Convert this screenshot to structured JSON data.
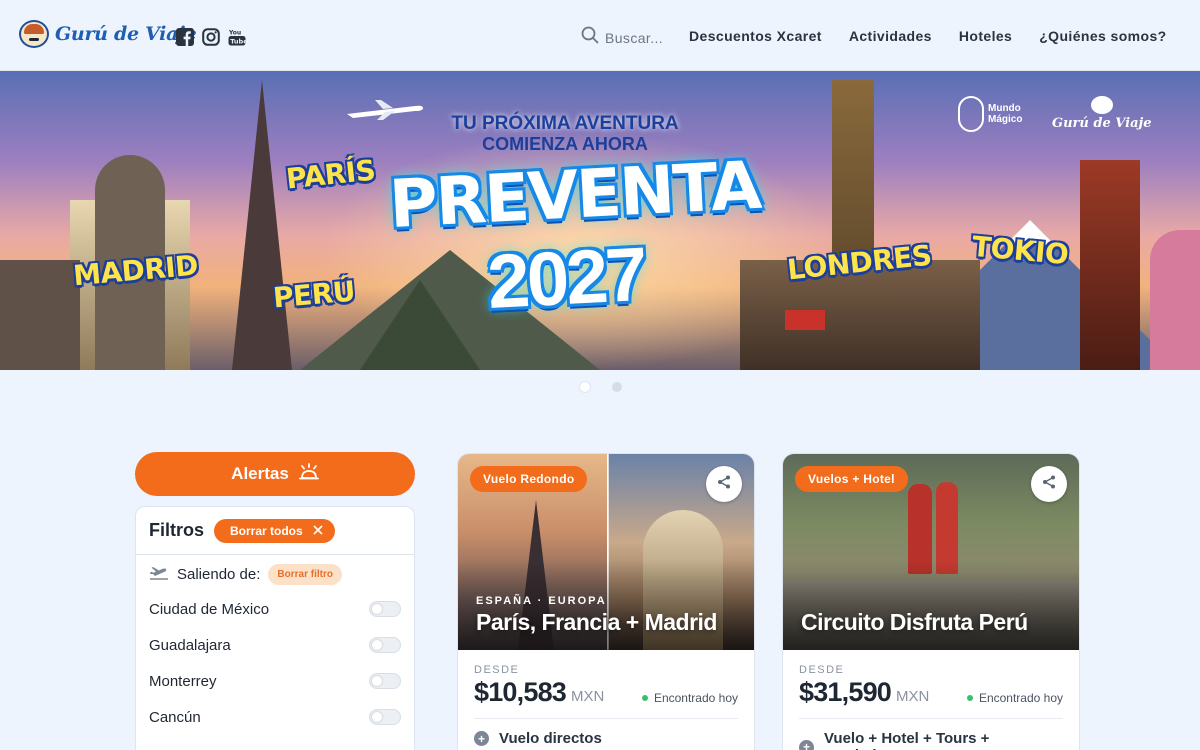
{
  "brand": {
    "name": "Gurú de Viaje"
  },
  "header": {
    "search_placeholder": "Buscar...",
    "nav": [
      "Descuentos Xcaret",
      "Actividades",
      "Hoteles",
      "¿Quiénes somos?"
    ]
  },
  "hero": {
    "tagline_line1": "TU PRÓXIMA AVENTURA",
    "tagline_line2": "COMIENZA AHORA",
    "headline": "PREVENTA",
    "year": "2027",
    "cities": [
      "MADRID",
      "PARÍS",
      "PERÚ",
      "LONDRES",
      "TOKIO"
    ],
    "partner_brand": "Mundo Mágico",
    "brand_small": "Gurú de Viaje",
    "slides_total": 2,
    "active_slide": 1
  },
  "sidebar": {
    "alerts_label": "Alertas",
    "filters_title": "Filtros",
    "clear_all_label": "Borrar todos",
    "leaving_label": "Saliendo de:",
    "clear_filter_label": "Borrar filtro",
    "cities": [
      "Ciudad de México",
      "Guadalajara",
      "Monterrey",
      "Cancún"
    ]
  },
  "cards": [
    {
      "badge": "Vuelo Redondo",
      "region": "ESPAÑA · EUROPA",
      "title": "París, Francia + Madrid",
      "desde": "DESDE",
      "price": "$10,583",
      "currency": "MXN",
      "status": "Encontrado hoy",
      "feature": "Vuelo directos"
    },
    {
      "badge": "Vuelos + Hotel",
      "region": "",
      "title": "Circuito Disfruta Perú",
      "desde": "DESDE",
      "price": "$31,590",
      "currency": "MXN",
      "status": "Encontrado hoy",
      "feature": "Vuelo + Hotel + Tours + Traslados"
    }
  ],
  "colors": {
    "accent": "#f26c1c",
    "page_bg": "#eef4fd",
    "brand_blue": "#1c3f9c",
    "status_green": "#3bbf6a"
  }
}
